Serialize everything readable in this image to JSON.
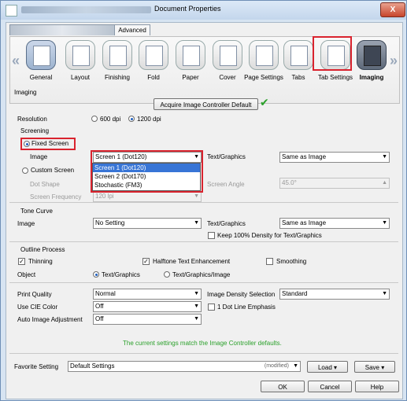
{
  "window": {
    "title": "Document Properties",
    "close_label": "X"
  },
  "tabs": {
    "advanced": "Advanced"
  },
  "toolbar": {
    "items": [
      {
        "label": "General"
      },
      {
        "label": "Layout"
      },
      {
        "label": "Finishing"
      },
      {
        "label": "Fold"
      },
      {
        "label": "Paper"
      },
      {
        "label": "Cover"
      },
      {
        "label": "Page Settings"
      },
      {
        "label": "Tabs"
      },
      {
        "label": "Tab Settings"
      },
      {
        "label": "Imaging"
      }
    ],
    "prev_arrow": "«",
    "next_arrow": "»"
  },
  "imaging": {
    "section_title": "Imaging",
    "acquire_button": "Acquire Image Controller Default",
    "check_mark": "✔",
    "resolution_label": "Resolution",
    "res_600": "600 dpi",
    "res_1200": "1200 dpi"
  },
  "screening": {
    "section_title": "Screening",
    "fixed_screen": "Fixed Screen",
    "image_label": "Image",
    "image_value": "Screen 1 (Dot120)",
    "text_graphics_label": "Text/Graphics",
    "text_graphics_value": "Same as Image",
    "custom_screen": "Custom Screen",
    "dot_shape_label": "Dot Shape",
    "screen_angle_label": "Screen Angle",
    "screen_angle_value": "45.0°",
    "screen_frequency_label": "Screen Frequency",
    "screen_frequency_value": "120 lpi",
    "dropdown_options": [
      "Screen 1 (Dot120)",
      "Screen 2 (Dot170)",
      "Stochastic (FM3)"
    ]
  },
  "tone_curve": {
    "section_title": "Tone Curve",
    "image_label": "Image",
    "image_value": "No Setting",
    "text_graphics_label": "Text/Graphics",
    "text_graphics_value": "Same as Image",
    "keep_density": "Keep 100% Density for Text/Graphics"
  },
  "outline": {
    "section_title": "Outline Process",
    "thinning": "Thinning",
    "halftone": "Halftone Text Enhancement",
    "smoothing": "Smoothing",
    "object_label": "Object",
    "obj_text_graphics": "Text/Graphics",
    "obj_text_graphics_image": "Text/Graphics/Image"
  },
  "quality": {
    "print_quality_label": "Print Quality",
    "print_quality_value": "Normal",
    "use_cie_label": "Use CIE Color",
    "use_cie_value": "Off",
    "auto_adjust_label": "Auto Image Adjustment",
    "auto_adjust_value": "Off",
    "density_label": "Image Density Selection",
    "density_value": "Standard",
    "one_dot": "1 Dot Line Emphasis"
  },
  "status": {
    "message": "The current settings match the Image Controller defaults."
  },
  "favorite": {
    "label": "Favorite Setting",
    "value": "Default Settings",
    "modified": "(modified)",
    "load": "Load",
    "save": "Save"
  },
  "dialog": {
    "ok": "OK",
    "cancel": "Cancel",
    "help": "Help"
  },
  "colors": {
    "highlight": "#d9232e",
    "accent_green": "#2aa02a",
    "selection": "#3875d6"
  }
}
